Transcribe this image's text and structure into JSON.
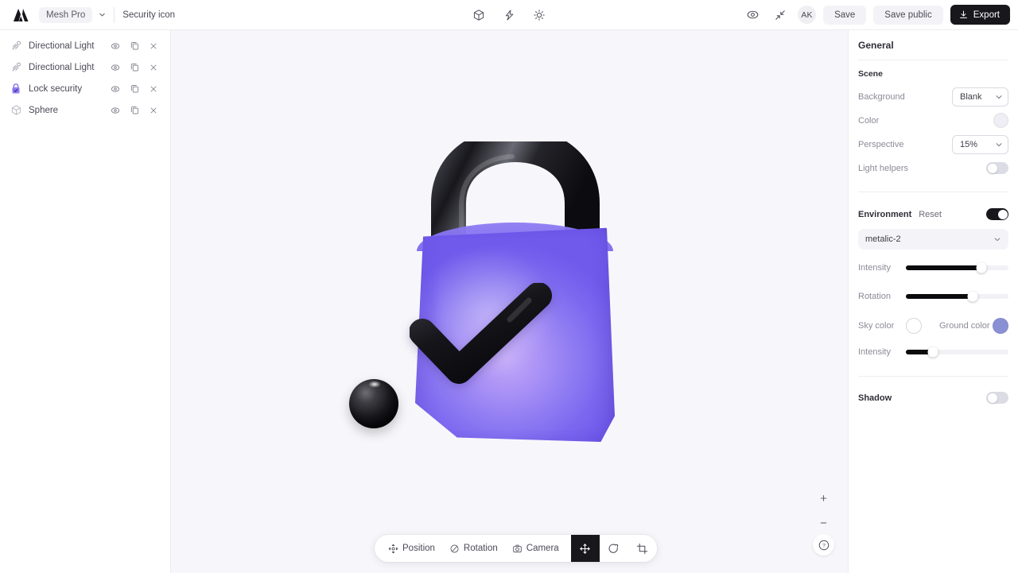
{
  "topbar": {
    "logo_icon": "mesh-logo-icon",
    "project_name": "Mesh Pro",
    "project_chevron_icon": "chevron-down-icon",
    "document_title": "Security icon",
    "center_icons": [
      {
        "name": "cube-icon",
        "title": "Objects"
      },
      {
        "name": "bolt-icon",
        "title": "Lights"
      },
      {
        "name": "sun-icon",
        "title": "Environment"
      }
    ],
    "preview_icon": "eye-preview-icon",
    "collapse_icon": "collapse-arrows-icon",
    "avatar_initials": "AK",
    "save_label": "Save",
    "save_public_label": "Save public",
    "export_label": "Export",
    "export_icon": "download-icon"
  },
  "sidebar": {
    "layers": [
      {
        "name": "Directional Light",
        "icon": "directional-light-icon",
        "selected": false
      },
      {
        "name": "Directional Light",
        "icon": "directional-light-icon",
        "selected": false
      },
      {
        "name": "Lock security",
        "icon": "lock-check-icon",
        "selected": true
      },
      {
        "name": "Sphere",
        "icon": "cube-outline-icon",
        "selected": false
      }
    ],
    "row_actions": [
      {
        "name": "toggle-visibility",
        "icon": "eye-icon"
      },
      {
        "name": "duplicate-layer",
        "icon": "copy-icon"
      },
      {
        "name": "delete-layer",
        "icon": "close-x-icon"
      }
    ]
  },
  "viewport": {
    "background_color": "#f7f7fb",
    "scene_objects": [
      {
        "name": "padlock-with-check",
        "body_color": "#7b67ef",
        "highlight_color": "#c3a8f8",
        "shackle_color": "#18181c",
        "check_color": "#1a1a1f"
      },
      {
        "name": "black-sphere",
        "color": "#0b0b0e"
      }
    ],
    "zoom_in_label": "+",
    "zoom_out_label": "−",
    "help_label": "?"
  },
  "bottom_toolbar": {
    "items": [
      {
        "label": "Position",
        "icon": "move-target-icon"
      },
      {
        "label": "Rotation",
        "icon": "rotate-slash-icon"
      },
      {
        "label": "Camera",
        "icon": "camera-icon"
      }
    ],
    "tools": [
      {
        "name": "translate-tool",
        "icon": "arrows-move-icon",
        "active": true
      },
      {
        "name": "rotate-tool",
        "icon": "circular-arrow-icon",
        "active": false
      },
      {
        "name": "scale-tool",
        "icon": "crop-icon",
        "active": false
      }
    ]
  },
  "right_panel": {
    "title": "General",
    "scene": {
      "heading": "Scene",
      "background_label": "Background",
      "background_value": "Blank",
      "background_options": [
        "Blank"
      ],
      "color_label": "Color",
      "color_value": "#eeeef4",
      "perspective_label": "Perspective",
      "perspective_value": "15%",
      "perspective_options": [
        "15%"
      ],
      "light_helpers_label": "Light helpers",
      "light_helpers_on": false
    },
    "environment": {
      "heading": "Environment",
      "reset_label": "Reset",
      "enabled": true,
      "preset_value": "metalic-2",
      "preset_chevron_icon": "chevron-down-icon",
      "intensity_label": "Intensity",
      "intensity_percent": 74,
      "rotation_label": "Rotation",
      "rotation_percent": 65,
      "sky_color_label": "Sky color",
      "sky_color_value": "#ffffff",
      "ground_color_label": "Ground color",
      "ground_color_value": "#8a90d4",
      "ground_intensity_label": "Intensity",
      "ground_intensity_percent": 26
    },
    "shadow": {
      "heading": "Shadow",
      "enabled": false
    }
  }
}
